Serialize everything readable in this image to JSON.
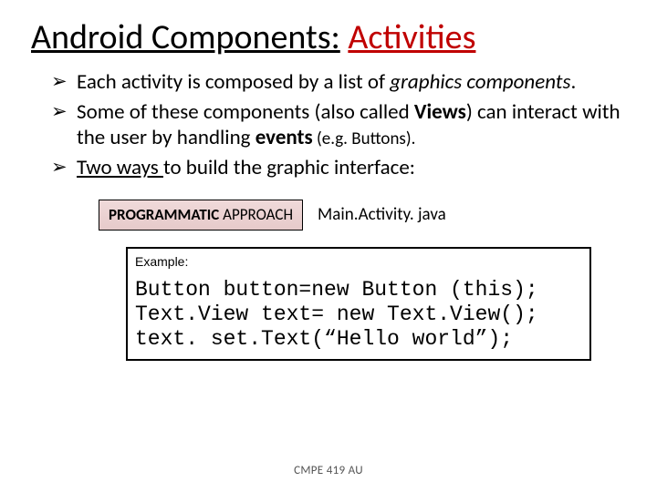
{
  "title": {
    "part1": "Android Components:",
    "part2": "Activities"
  },
  "bullets": {
    "b1_pre": "Each activity is composed by a list of ",
    "b1_it": "graphics components",
    "b1_post": ".",
    "b2_pre": "Some of these components (also called ",
    "b2_bold": "Views",
    "b2_mid": ") can interact with the user by handling ",
    "b2_bold2": "events",
    "b2_small": " (e.g. Buttons).",
    "b3_pre": "",
    "b3_underline": "Two ways ",
    "b3_post": "to build the graphic interface:"
  },
  "badge": {
    "bold": "PROGRAMMATIC",
    "rest": " APPROACH"
  },
  "filename": "Main.Activity. java",
  "example_label": "Example:",
  "code": "Button button=new Button (this);\nText.View text= new Text.View();\ntext. set.Text(“Hello world”);",
  "footer": "CMPE 419 AU"
}
